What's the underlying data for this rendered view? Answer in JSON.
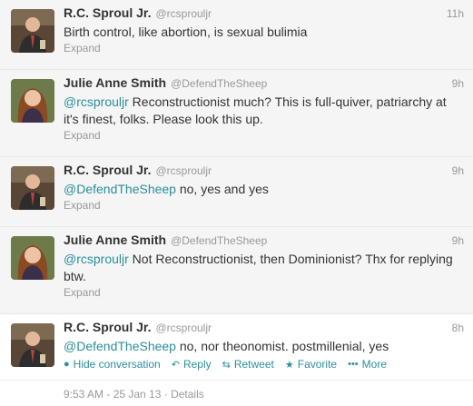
{
  "tweets": [
    {
      "fullname": "R.C. Sproul Jr.",
      "screenname": "@rcsprouljr",
      "time": "11h",
      "mention": "",
      "text": "Birth control, like abortion, is sexual bulimia",
      "expand": "Expand",
      "avatar": "rc-sproul-avatar"
    },
    {
      "fullname": "Julie Anne Smith",
      "screenname": "@DefendTheSheep",
      "time": "9h",
      "mention": "@rcsprouljr",
      "text": " Reconstructionist much? This is full-quiver, patriarchy at it's finest, folks. Please look this up.",
      "expand": "Expand",
      "avatar": "julie-anne-avatar"
    },
    {
      "fullname": "R.C. Sproul Jr.",
      "screenname": "@rcsprouljr",
      "time": "9h",
      "mention": "@DefendTheSheep",
      "text": " no, yes and yes",
      "expand": "Expand",
      "avatar": "rc-sproul-avatar"
    },
    {
      "fullname": "Julie Anne Smith",
      "screenname": "@DefendTheSheep",
      "time": "9h",
      "mention": "@rcsprouljr",
      "text": " Not Reconstructionist, then Dominionist? Thx for replying btw.",
      "expand": "Expand",
      "avatar": "julie-anne-avatar"
    },
    {
      "fullname": "R.C. Sproul Jr.",
      "screenname": "@rcsprouljr",
      "time": "8h",
      "mention": "@DefendTheSheep",
      "text": " no, nor theonomist. postmillenial, yes",
      "avatar": "rc-sproul-avatar"
    }
  ],
  "actions": {
    "hide": "Hide conversation",
    "reply": "Reply",
    "retweet": "Retweet",
    "favorite": "Favorite",
    "more": "More"
  },
  "details": "9:53 AM - 25 Jan 13 · Details",
  "colors": {
    "link": "#2a8f9a",
    "muted": "#999999",
    "faded_bg": "#f5f5f5"
  }
}
